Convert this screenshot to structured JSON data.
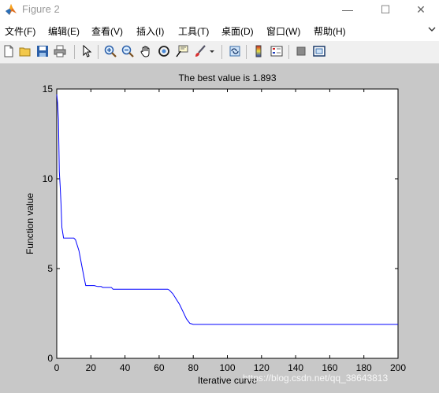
{
  "window": {
    "title": "Figure 2",
    "controls": {
      "minimize": "—",
      "maximize": "☐",
      "close": "✕"
    }
  },
  "menu": {
    "items": [
      "文件(F)",
      "编辑(E)",
      "查看(V)",
      "插入(I)",
      "工具(T)",
      "桌面(D)",
      "窗口(W)",
      "帮助(H)"
    ],
    "overflow_icon": "menu-overflow-arrow"
  },
  "toolbar": {
    "icons": [
      "new-figure-icon",
      "open-file-icon",
      "save-icon",
      "print-icon",
      "edit-plot-arrow-icon",
      "zoom-in-icon",
      "zoom-out-icon",
      "pan-hand-icon",
      "rotate-3d-icon",
      "data-cursor-icon",
      "brush-icon",
      "brush-dropdown-icon",
      "link-plot-icon",
      "colorbar-icon",
      "legend-icon",
      "hide-plot-tools-icon",
      "show-plot-tools-icon"
    ]
  },
  "colors": {
    "figure_background": "#c8c8c8",
    "axes_background": "#ffffff",
    "line": "#0000ff"
  },
  "chart_data": {
    "type": "line",
    "title": "The best value is 1.893",
    "xlabel": "Iterative curve",
    "ylabel": "Function value",
    "xlim": [
      0,
      200
    ],
    "ylim": [
      0,
      15
    ],
    "xticks": [
      0,
      20,
      40,
      60,
      80,
      100,
      120,
      140,
      160,
      180,
      200
    ],
    "yticks": [
      0,
      5,
      10,
      15
    ],
    "grid": false,
    "series": [
      {
        "x": [
          0,
          0.5,
          1,
          1.5,
          2,
          2.5,
          3,
          3.5,
          4,
          5,
          6,
          8,
          10,
          11,
          12,
          13,
          14,
          15,
          16,
          17,
          18,
          20,
          22,
          24,
          26,
          27,
          28,
          30,
          32,
          33,
          34,
          36,
          40,
          45,
          50,
          55,
          60,
          62,
          64,
          65,
          66,
          68,
          70,
          72,
          74,
          76,
          78,
          80,
          90,
          100,
          120,
          140,
          160,
          180,
          200
        ],
        "y": [
          14.7,
          14.2,
          13.3,
          10.4,
          9.6,
          8.6,
          7.3,
          7.0,
          6.7,
          6.7,
          6.7,
          6.7,
          6.7,
          6.6,
          6.3,
          6.0,
          5.5,
          5.0,
          4.5,
          4.05,
          4.05,
          4.05,
          4.05,
          4.0,
          4.0,
          3.95,
          3.95,
          3.95,
          3.95,
          3.85,
          3.85,
          3.85,
          3.85,
          3.85,
          3.85,
          3.85,
          3.85,
          3.85,
          3.85,
          3.85,
          3.8,
          3.6,
          3.3,
          3.0,
          2.6,
          2.2,
          1.95,
          1.893,
          1.893,
          1.893,
          1.893,
          1.893,
          1.893,
          1.893,
          1.893
        ]
      }
    ]
  },
  "watermark": "https://blog.csdn.net/qq_38643813"
}
